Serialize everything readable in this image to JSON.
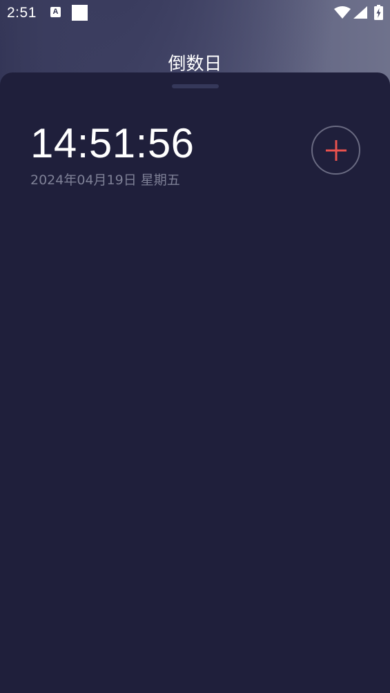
{
  "status_bar": {
    "time": "2:51",
    "notification_icon_letter": "A",
    "icons": [
      "a-notification-icon",
      "square-notification-icon",
      "wifi-icon",
      "signal-icon",
      "battery-charging-icon"
    ]
  },
  "app": {
    "title": "倒数日"
  },
  "main": {
    "clock_time": "14:51:56",
    "date_text": "2024年04月19日 星期五",
    "add_button_icon": "plus-icon"
  },
  "colors": {
    "sheet_background": "#1f1f3b",
    "accent_red": "#e9524e",
    "text_primary": "#ffffff",
    "text_secondary": "#7e8096"
  }
}
